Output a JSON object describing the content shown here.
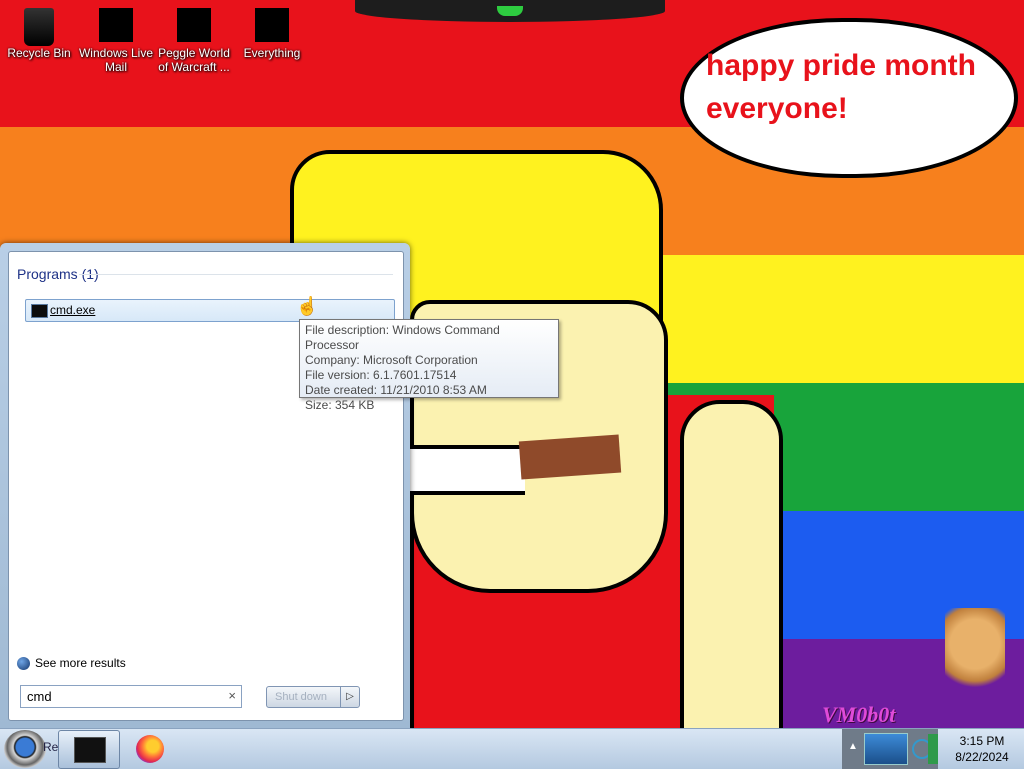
{
  "desktop": {
    "icons": [
      {
        "label": "Recycle Bin",
        "icon": "recycle-bin-icon"
      },
      {
        "label": "Windows Live Mail",
        "icon": "app-icon"
      },
      {
        "label": "Peggle World of Warcraft ...",
        "icon": "app-icon"
      },
      {
        "label": "Everything",
        "icon": "app-icon"
      }
    ],
    "bubble_text": "happy pride month everyone!",
    "watermark": "VM0b0t"
  },
  "start_menu": {
    "programs_header": "Programs (1)",
    "results": [
      {
        "label": "cmd.exe",
        "icon": "console-icon"
      }
    ],
    "see_more": "See more results",
    "search_value": "cmd",
    "search_clear": "×",
    "shutdown_label": "Shut down",
    "shutdown_arrow": "▷"
  },
  "tooltip": {
    "line1": "File description: Windows Command Processor",
    "line2": "Company: Microsoft Corporation",
    "line3": "File version: 6.1.7601.17514",
    "line4": "Date created: 11/21/2010 8:53 AM",
    "line5": "Size: 354 KB"
  },
  "taskbar": {
    "start_partial": "Re",
    "tray_up": "▲",
    "clock_time": "3:15 PM",
    "clock_date": "8/22/2024"
  }
}
